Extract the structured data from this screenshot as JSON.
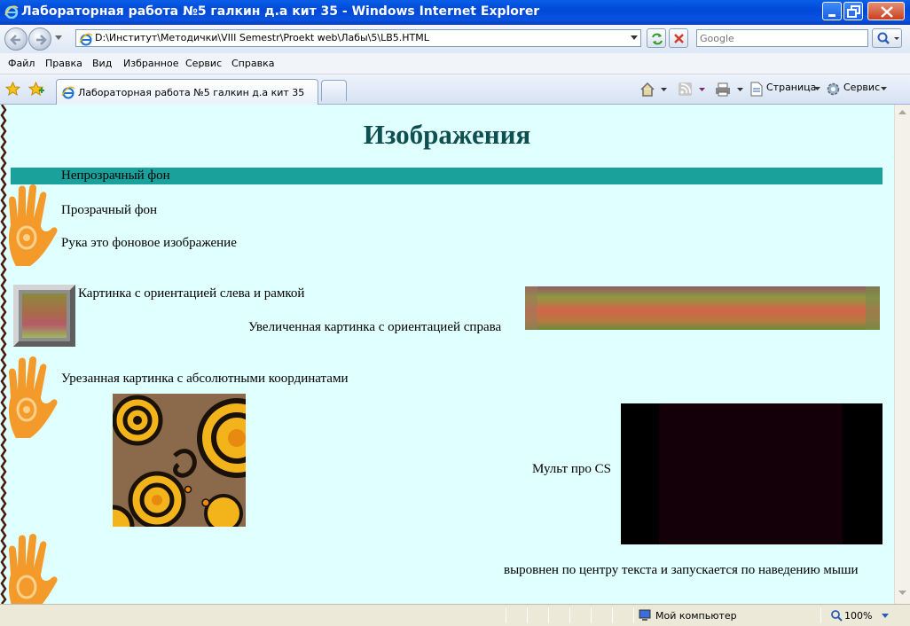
{
  "window": {
    "title": "Лабораторная работа №5 галкин д.а кит 35 - Windows Internet Explorer"
  },
  "address_bar": {
    "url": "D:\\Институт\\Методички\\VIII Semestr\\Proekt web\\Лабы\\5\\LB5.HTML",
    "search_placeholder": "Google"
  },
  "menu": [
    "Файл",
    "Правка",
    "Вид",
    "Избранное",
    "Сервис",
    "Справка"
  ],
  "tab": {
    "title": "Лабораторная работа №5 галкин д.а кит 35"
  },
  "toolbar": {
    "page_label": "Страница",
    "tools_label": "Сервис"
  },
  "page": {
    "heading": "Изображения",
    "opaque_bg": "Непрозрачный фон",
    "transparent_bg": "Прозрачный фон",
    "hand_bg": "Рука это фоновое изображение",
    "left_image_caption": "Картинка с ориентацией слева и рамкой",
    "right_image_caption": "Увеличенная картинка с ориентацией справа",
    "clipped_caption": "Урезанная картинка с абсолютными координатами",
    "video_label": "Мульт про CS",
    "video_note": "выровнен по центру текста и запускается по наведению мыши"
  },
  "status": {
    "zone": "Мой компьютер",
    "zoom": "100%"
  },
  "colors": {
    "page_bg": "#e0ffff",
    "opaque_band": "#1aa19b",
    "heading": "#0f4f4f",
    "hand": "#f39a2a"
  }
}
